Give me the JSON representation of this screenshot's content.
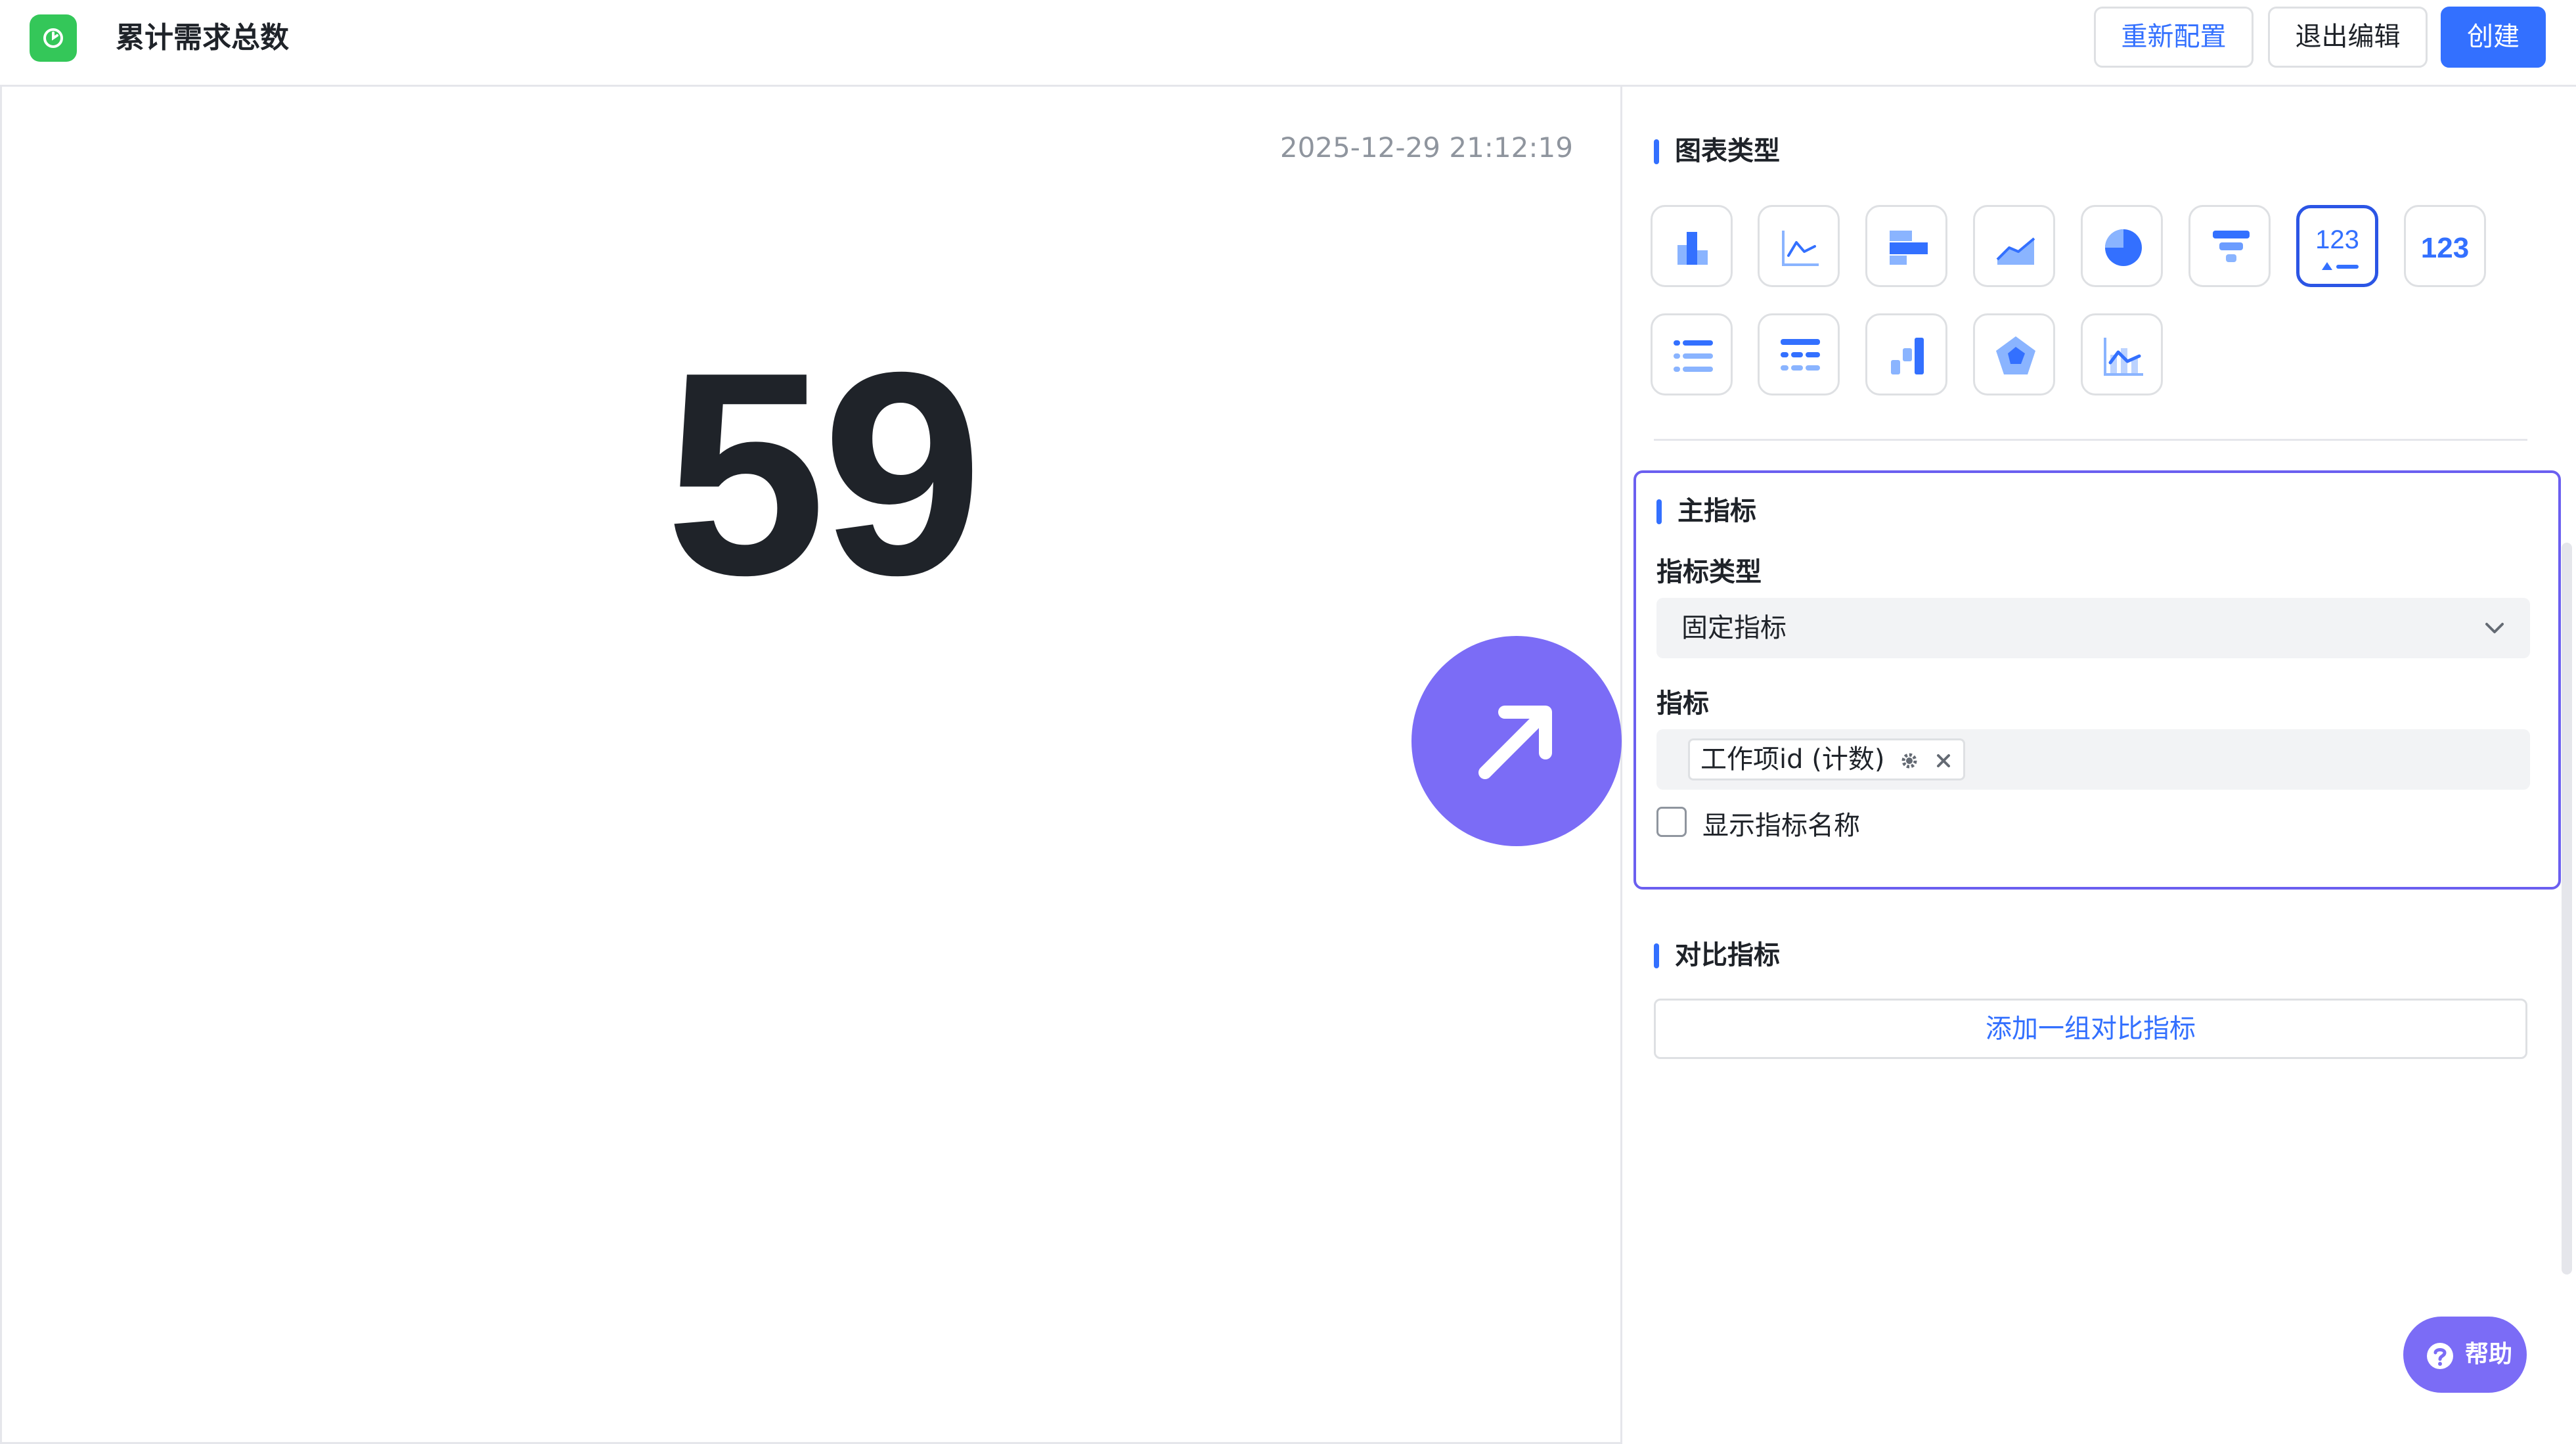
{
  "header": {
    "title": "累计需求总数",
    "reconfig_label": "重新配置",
    "exit_label": "退出编辑",
    "create_label": "创建"
  },
  "preview": {
    "timestamp": "2025-12-29 21:12:19",
    "value": "59"
  },
  "config": {
    "chart_type_title": "图表类型",
    "chart_types": [
      "bar-chart-icon",
      "line-chart-icon",
      "horizontal-bar-chart-icon",
      "area-chart-icon",
      "pie-chart-icon",
      "funnel-chart-icon",
      "metric-card-trend-icon",
      "metric-card-icon",
      "list-icon",
      "table-icon",
      "waterfall-chart-icon",
      "radar-chart-icon",
      "combo-chart-icon"
    ],
    "selected_chart_type": "metric-card-trend-icon",
    "metric_card_text": "123",
    "main_metric": {
      "title": "主指标",
      "metric_type_label": "指标类型",
      "metric_type_value": "固定指标",
      "metric_label": "指标",
      "metric_tag": "工作项id (计数)",
      "show_name_label": "显示指标名称",
      "show_name_checked": false
    },
    "compare_metric": {
      "title": "对比指标",
      "add_label": "添加一组对比指标"
    },
    "help_label": "帮助"
  },
  "colors": {
    "accent": "#3370ff",
    "purple": "#7b6cf6",
    "logo_green": "#34c759"
  }
}
